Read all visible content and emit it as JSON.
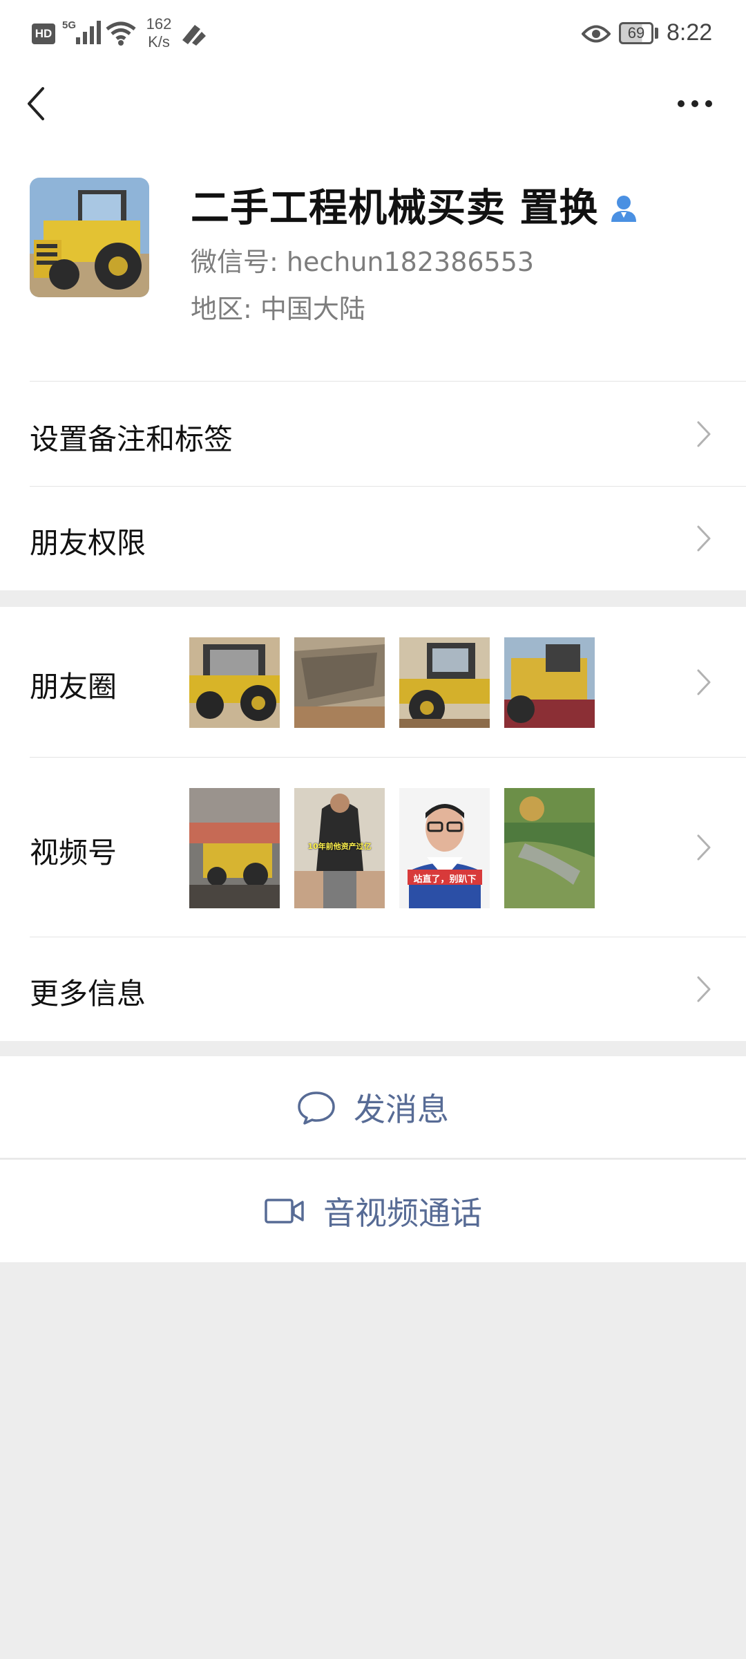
{
  "status_bar": {
    "network_badge": "HD",
    "network_type": "5G",
    "speed_value": "162",
    "speed_unit": "K/s",
    "battery": "69",
    "time": "8:22"
  },
  "nav": {
    "back_icon": "chevron-left-icon",
    "more_icon": "more-dots-icon"
  },
  "profile": {
    "name": "二手工程机械买卖 置换",
    "wechat_id": "微信号:  hechun182386553",
    "region": "地区:  中国大陆",
    "verified_icon": "person-icon"
  },
  "menu": {
    "remark_label": "设置备注和标签",
    "permission_label": "朋友权限",
    "moments_label": "朋友圈",
    "channels_label": "视频号",
    "more_info_label": "更多信息"
  },
  "channels_thumbs": [
    {
      "caption": ""
    },
    {
      "caption": "10年前他资产过亿"
    },
    {
      "caption": "站直了，别趴下"
    },
    {
      "caption": ""
    }
  ],
  "actions": {
    "message_label": "发消息",
    "call_label": "音视频通话"
  },
  "colors": {
    "link_blue": "#576b95",
    "background": "#ededed",
    "verified_blue": "#4a90e2"
  }
}
